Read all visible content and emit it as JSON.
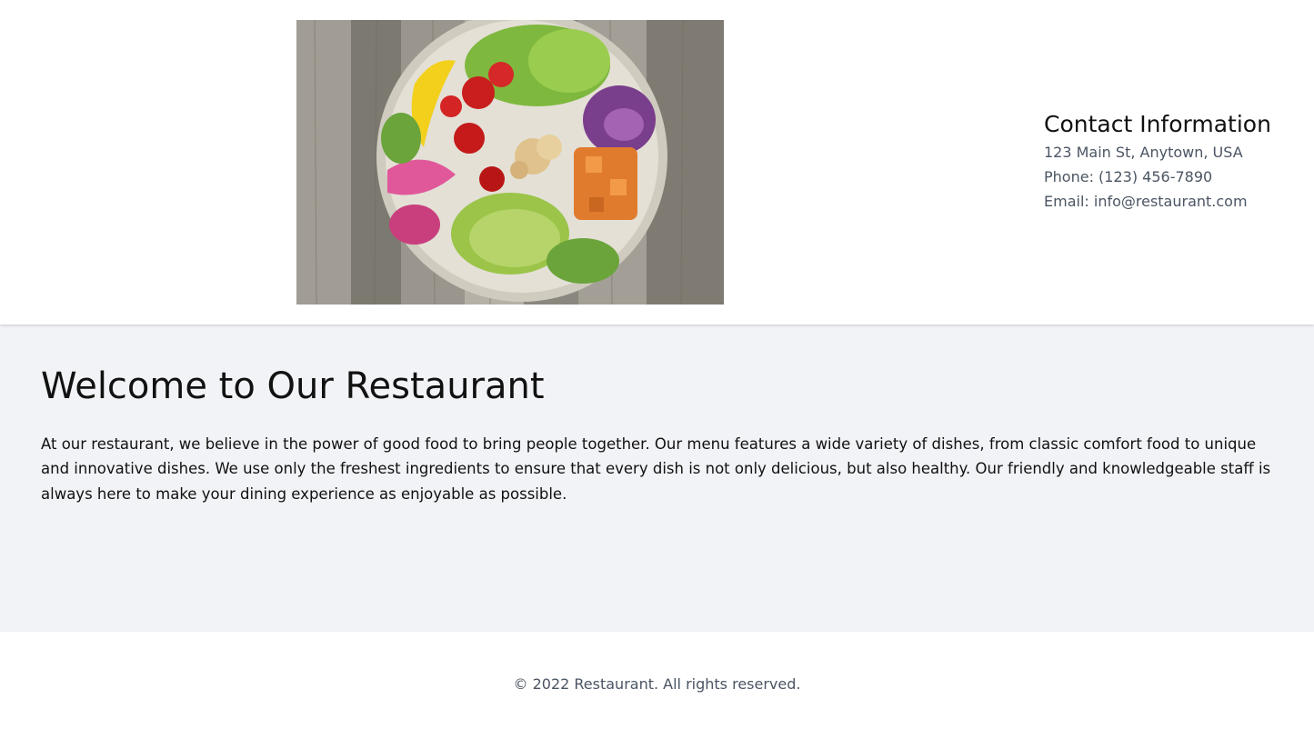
{
  "header": {
    "image_alt": "salad bowl",
    "contact": {
      "title": "Contact Information",
      "address": "123 Main St, Anytown, USA",
      "phone": "Phone: (123) 456-7890",
      "email": "Email: info@restaurant.com"
    }
  },
  "main": {
    "title": "Welcome to Our Restaurant",
    "text": "At our restaurant, we believe in the power of good food to bring people together. Our menu features a wide variety of dishes, from classic comfort food to unique and innovative dishes. We use only the freshest ingredients to ensure that every dish is not only delicious, but also healthy. Our friendly and knowledgeable staff is always here to make your dining experience as enjoyable as possible."
  },
  "footer": {
    "copyright": "© 2022 Restaurant. All rights reserved."
  },
  "colors": {
    "main_bg": "#f2f3f6",
    "muted_text": "#4b5563",
    "text": "#111111"
  }
}
